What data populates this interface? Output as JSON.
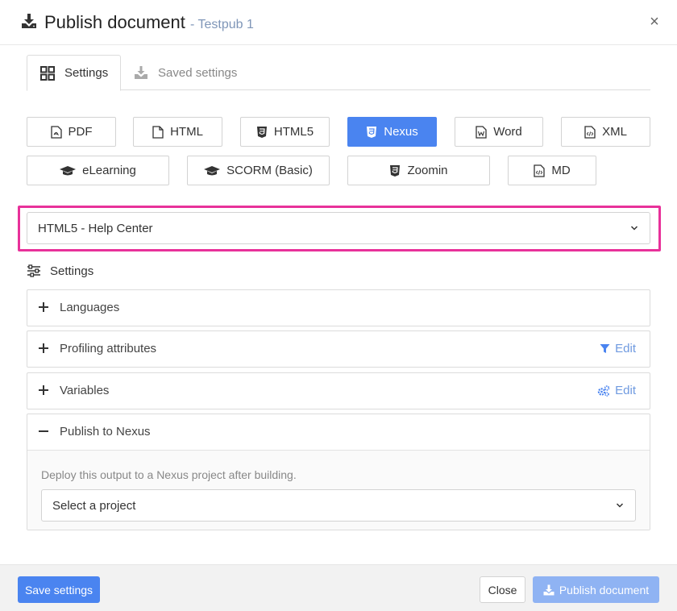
{
  "header": {
    "title": "Publish document",
    "subtitle": "- Testpub 1",
    "icon": "download-icon",
    "close_icon": "close-icon"
  },
  "tabs": [
    {
      "label": "Settings",
      "icon": "grid-icon",
      "active": true
    },
    {
      "label": "Saved settings",
      "icon": "saved-download-icon",
      "active": false
    }
  ],
  "formats": [
    {
      "label": "PDF",
      "icon": "pdf-file-icon",
      "active": false
    },
    {
      "label": "HTML",
      "icon": "file-icon",
      "active": false
    },
    {
      "label": "HTML5",
      "icon": "html5-icon",
      "active": false
    },
    {
      "label": "Nexus",
      "icon": "html5-icon",
      "active": true
    },
    {
      "label": "Word",
      "icon": "word-file-icon",
      "active": false
    },
    {
      "label": "XML",
      "icon": "code-file-icon",
      "active": false
    },
    {
      "label": "eLearning",
      "icon": "graduation-cap-icon",
      "active": false
    },
    {
      "label": "SCORM (Basic)",
      "icon": "graduation-cap-icon",
      "active": false
    },
    {
      "label": "Zoomin",
      "icon": "html5-icon",
      "active": false
    },
    {
      "label": "MD",
      "icon": "code-file-icon",
      "active": false
    }
  ],
  "template_select": {
    "value": "HTML5 - Help Center"
  },
  "settings_label": "Settings",
  "accordions": [
    {
      "title": "Languages",
      "expanded": false
    },
    {
      "title": "Profiling attributes",
      "expanded": false,
      "edit_label": "Edit",
      "edit_icon": "filter-icon"
    },
    {
      "title": "Variables",
      "expanded": false,
      "edit_label": "Edit",
      "edit_icon": "gears-icon"
    },
    {
      "title": "Publish to Nexus",
      "expanded": true,
      "description": "Deploy this output to a Nexus project after building.",
      "project_select": "Select a project"
    }
  ],
  "footer": {
    "save_label": "Save settings",
    "close_label": "Close",
    "publish_label": "Publish document"
  },
  "colors": {
    "accent": "#4a84f0",
    "highlight": "#e8319a"
  }
}
